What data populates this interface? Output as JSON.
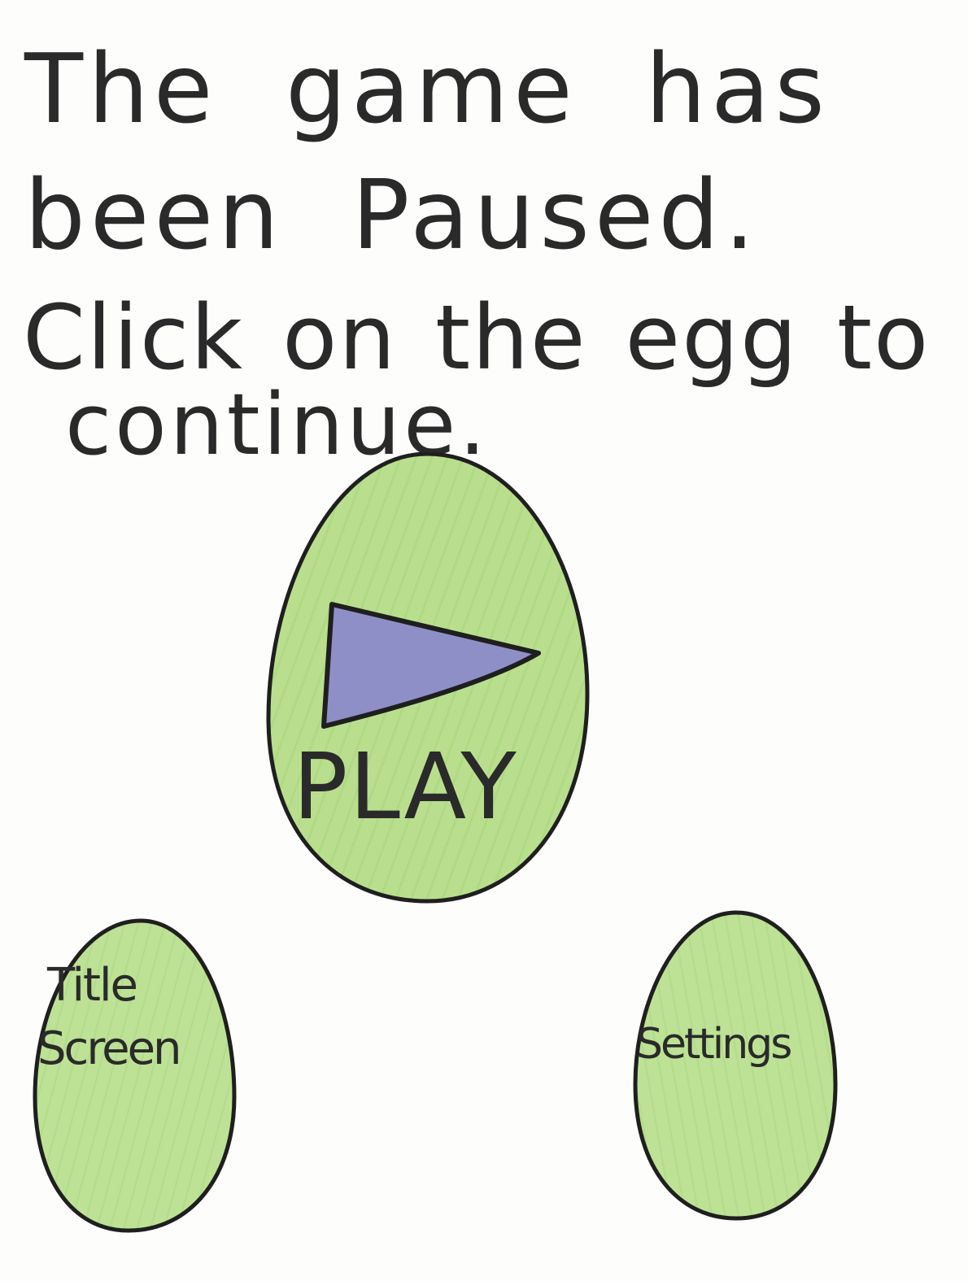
{
  "pause_message": {
    "line1": "The game has",
    "line2": "been Paused.",
    "line3": "Click on the egg to",
    "line4": "continue."
  },
  "play_button": {
    "label": "PLAY",
    "icon": "play-triangle-icon"
  },
  "title_screen_button": {
    "label_line1": "Title",
    "label_line2": "Screen"
  },
  "settings_button": {
    "label": "Settings"
  },
  "colors": {
    "egg_fill": "#b5dd8a",
    "egg_stroke": "#1f1f1f",
    "play_icon_fill": "#8e8ec6",
    "ink": "#2a2a2a",
    "background": "#fdfdfc"
  }
}
